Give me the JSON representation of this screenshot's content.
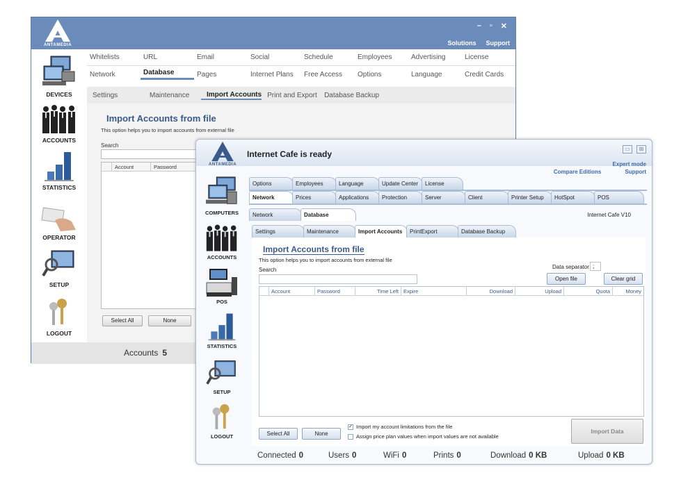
{
  "back_window": {
    "brand": "ANTAMEDIA",
    "window_controls": [
      "–",
      "▫",
      "✕"
    ],
    "header_links": [
      "Solutions",
      "Support"
    ],
    "sidebar": [
      {
        "label": "DEVICES",
        "icon": "devices-icon"
      },
      {
        "label": "ACCOUNTS",
        "icon": "accounts-icon"
      },
      {
        "label": "STATISTICS",
        "icon": "statistics-icon"
      },
      {
        "label": "OPERATOR",
        "icon": "operator-icon"
      },
      {
        "label": "SETUP",
        "icon": "setup-icon"
      },
      {
        "label": "LOGOUT",
        "icon": "logout-icon"
      }
    ],
    "tabs_row1": [
      "Whitelists",
      "URL",
      "Email",
      "Social",
      "Schedule",
      "Employees",
      "Advertising",
      "License"
    ],
    "tabs_row2": [
      "Network",
      "Database",
      "Pages",
      "Internet Plans",
      "Free Access",
      "Options",
      "Language",
      "Credit Cards"
    ],
    "active_tab": "Database",
    "subtabs": [
      "Settings",
      "Maintenance",
      "Import Accounts",
      "Print and Export",
      "Database Backup"
    ],
    "active_subtab": "Import Accounts",
    "heading": "Import Accounts from file",
    "description": "This option helps you to import accounts from external file",
    "search_label": "Search",
    "grid_columns": [
      "Account",
      "Password"
    ],
    "select_all": "Select All",
    "none": "None",
    "footer_label": "Accounts",
    "footer_count": "5"
  },
  "front_window": {
    "brand": "ANTAMEDIA",
    "title": "Internet Cafe is ready",
    "window_controls": [
      "▭",
      "⊠"
    ],
    "expert_mode": "Expert mode",
    "header_links": [
      "Compare Editions",
      "Support"
    ],
    "sidebar": [
      {
        "label": "COMPUTERS",
        "icon": "computers-icon"
      },
      {
        "label": "ACCOUNTS",
        "icon": "accounts-icon"
      },
      {
        "label": "POS",
        "icon": "pos-icon"
      },
      {
        "label": "STATISTICS",
        "icon": "statistics-icon"
      },
      {
        "label": "SETUP",
        "icon": "setup-icon"
      },
      {
        "label": "LOGOUT",
        "icon": "logout-icon"
      }
    ],
    "tabs_row1": [
      "Options",
      "Employees",
      "Language",
      "Update Center",
      "License"
    ],
    "tabs_row2": [
      "Network",
      "Prices",
      "Applications",
      "Protection",
      "Server",
      "Client",
      "Printer Setup",
      "HotSpot",
      "POS"
    ],
    "tabs_row3": [
      "Network",
      "Database"
    ],
    "subtabs": [
      "Settings",
      "Maintenance",
      "Import Accounts",
      "PrintExport",
      "Database Backup"
    ],
    "version": "Internet Cafe V10",
    "heading": "Import Accounts from file",
    "description": "This option helps you to import accounts from external file",
    "search_label": "Search",
    "separator_label": "Data separator",
    "separator_value": ";",
    "open_file": "Open file",
    "clear_grid": "Clear grid",
    "grid_columns": [
      "Account",
      "Password",
      "Time Left",
      "Expire",
      "Download",
      "Upload",
      "Quota",
      "Money"
    ],
    "select_all": "Select All",
    "none": "None",
    "check1": "Import my account limitations from the file",
    "check1_checked": true,
    "check2": "Assign price plan values when import values are not available",
    "check2_checked": false,
    "import_data": "Import Data",
    "status": [
      {
        "label": "Connected",
        "value": "0"
      },
      {
        "label": "Users",
        "value": "0"
      },
      {
        "label": "WiFi",
        "value": "0"
      },
      {
        "label": "Prints",
        "value": "0"
      },
      {
        "label": "Download",
        "value": "0 KB"
      },
      {
        "label": "Upload",
        "value": "0 KB"
      }
    ]
  },
  "colors": {
    "back_header": "#6b8cba",
    "heading_blue": "#3a5a8a",
    "link_blue": "#3a6ab0",
    "tab_gradient_end": "#c9d8ea"
  }
}
